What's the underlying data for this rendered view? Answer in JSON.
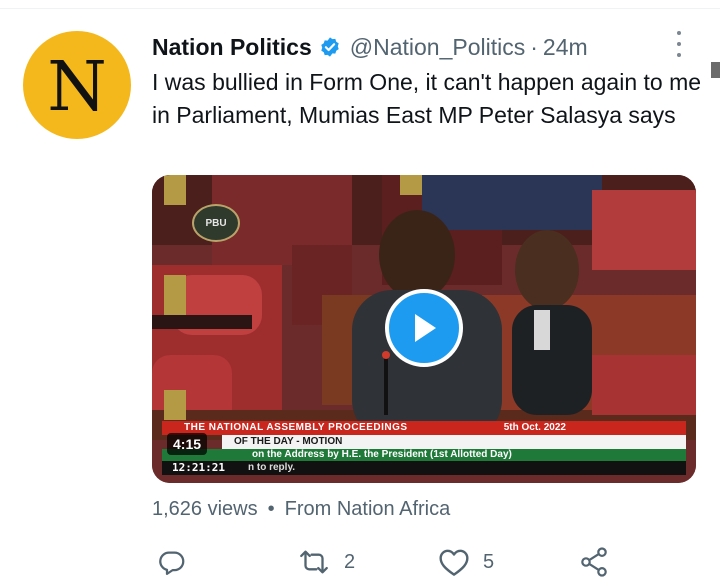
{
  "tweet": {
    "avatar_letter": "N",
    "display_name": "Nation Politics",
    "handle": "@Nation_Politics",
    "separator": "·",
    "time": "24m",
    "text": "I was bullied in Form One, it can't happen again to me in Parliament, Mumias East MP Peter Salasya says",
    "verified_icon": "verified-badge-icon",
    "more_icon": "more-vertical-icon"
  },
  "media": {
    "watermark": "PBU",
    "duration": "4:15",
    "play_icon": "play-icon",
    "banner_title": "THE NATIONAL ASSEMBLY PROCEEDINGS",
    "banner_date": "5th Oct. 2022",
    "banner_order": "OF THE DAY - MOTION",
    "banner_debate": "on the Address by H.E. the President (1st Allotted Day)",
    "clock": "12:21:21",
    "banner_tail": "n to reply."
  },
  "meta": {
    "views": "1,626 views",
    "bullet": "•",
    "source": "From Nation Africa"
  },
  "actions": {
    "reply_icon": "reply-icon",
    "retweet_icon": "retweet-icon",
    "retweet_count": "2",
    "like_icon": "heart-icon",
    "like_count": "5",
    "share_icon": "share-icon"
  },
  "colors": {
    "accent": "#1d9bf0",
    "avatar_bg": "#f5b81c",
    "secondary_text": "#536471"
  }
}
